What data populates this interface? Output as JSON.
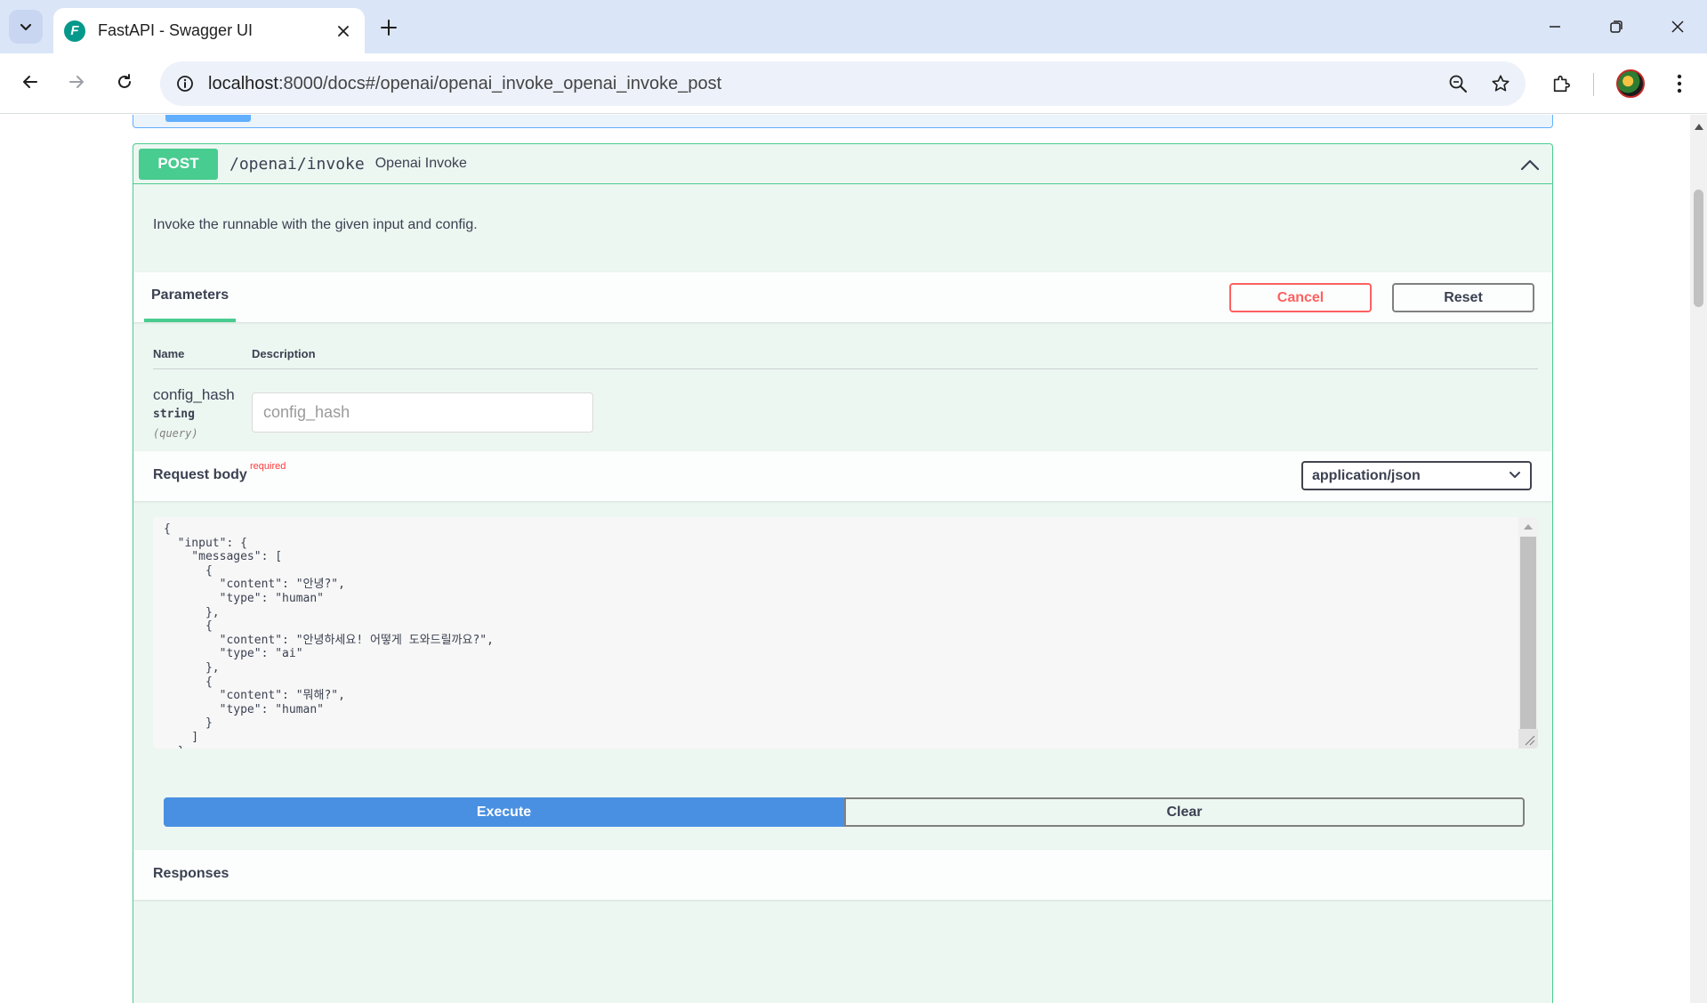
{
  "browser": {
    "tab_title": "FastAPI - Swagger UI",
    "favicon_letter": "F",
    "url_host": "localhost",
    "url_rest": ":8000/docs#/openai/openai_invoke_openai_invoke_post"
  },
  "operation": {
    "method": "POST",
    "path": "/openai/invoke",
    "summary": "Openai Invoke",
    "description": "Invoke the runnable with the given input and config."
  },
  "parameters": {
    "tab_label": "Parameters",
    "cancel_label": "Cancel",
    "reset_label": "Reset",
    "col_name": "Name",
    "col_description": "Description",
    "items": [
      {
        "name": "config_hash",
        "type": "string",
        "in": "(query)",
        "placeholder": "config_hash"
      }
    ]
  },
  "request_body": {
    "title": "Request body",
    "required_label": "required",
    "content_type": "application/json",
    "json_text": "{\n  \"input\": {\n    \"messages\": [\n      {\n        \"content\": \"안녕?\",\n        \"type\": \"human\"\n      },\n      {\n        \"content\": \"안녕하세요! 어떻게 도와드릴까요?\",\n        \"type\": \"ai\"\n      },\n      {\n        \"content\": \"뭐해?\",\n        \"type\": \"human\"\n      }\n    ]\n  },\n  \"config\": {},\n  \"kwargs\": {}\n}"
  },
  "actions": {
    "execute_label": "Execute",
    "clear_label": "Clear"
  },
  "responses": {
    "title": "Responses"
  },
  "colors": {
    "post_green": "#49cc90",
    "get_blue": "#61affe",
    "execute_blue": "#4990e2",
    "cancel_red": "#ff6060"
  },
  "icons": [
    "tab-search-icon",
    "close-icon",
    "plus-icon",
    "minimize-icon",
    "restore-icon",
    "window-close-icon",
    "back-icon",
    "forward-icon",
    "reload-icon",
    "site-info-icon",
    "zoom-icon",
    "star-icon",
    "extensions-icon",
    "menu-icon",
    "chevron-up-icon",
    "chevron-down-icon"
  ]
}
